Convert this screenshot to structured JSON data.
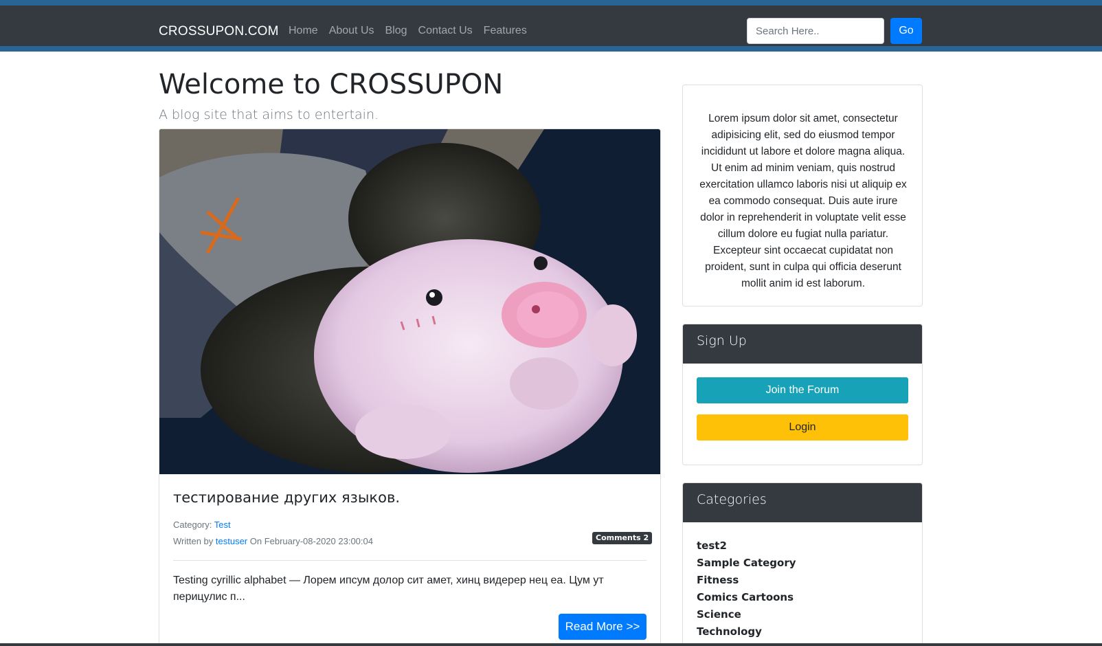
{
  "nav": {
    "brand": "CROSSUPON.COM",
    "links": [
      "Home",
      "About Us",
      "Blog",
      "Contact Us",
      "Features"
    ],
    "search_placeholder": "Search Here..",
    "go_label": "Go"
  },
  "header": {
    "title": "Welcome to CROSSUPON",
    "subtitle": "A blog site that aims to entertain."
  },
  "post": {
    "title": "тестирование других языков.",
    "category_label": "Category: ",
    "category": "Test",
    "written_by_label": "Written by ",
    "author": "testuser",
    "date_text": " On February-08-2020 23:00:04",
    "comments_badge": "Comments 2",
    "excerpt": "Testing cyrillic alphabet — Лорем ипсум долор сит амет, хинц видерер нец еа. Цум ут перицулис п...",
    "read_more_label": "Read More >>"
  },
  "sidebar": {
    "about_text": "Lorem ipsum dolor sit amet, consectetur adipisicing elit, sed do eiusmod tempor incididunt ut labore et dolore magna aliqua. Ut enim ad minim veniam, quis nostrud exercitation ullamco laboris nisi ut aliquip ex ea commodo consequat. Duis aute irure dolor in reprehenderit in voluptate velit esse cillum dolore eu fugiat nulla pariatur. Excepteur sint occaecat cupidatat non proident, sunt in culpa qui officia deserunt mollit anim id est laborum.",
    "signup_title": "Sign Up",
    "join_label": "Join the Forum",
    "login_label": "Login",
    "categories_title": "Categories",
    "categories": [
      "test2",
      "Sample Category",
      "Fitness",
      "Comics Cartoons",
      "Science",
      "Technology"
    ]
  },
  "colors": {
    "navbar": "#343a40",
    "navbar_accent": "#2a6496",
    "primary": "#007bff",
    "info": "#17a2b8",
    "warning": "#ffc107"
  }
}
